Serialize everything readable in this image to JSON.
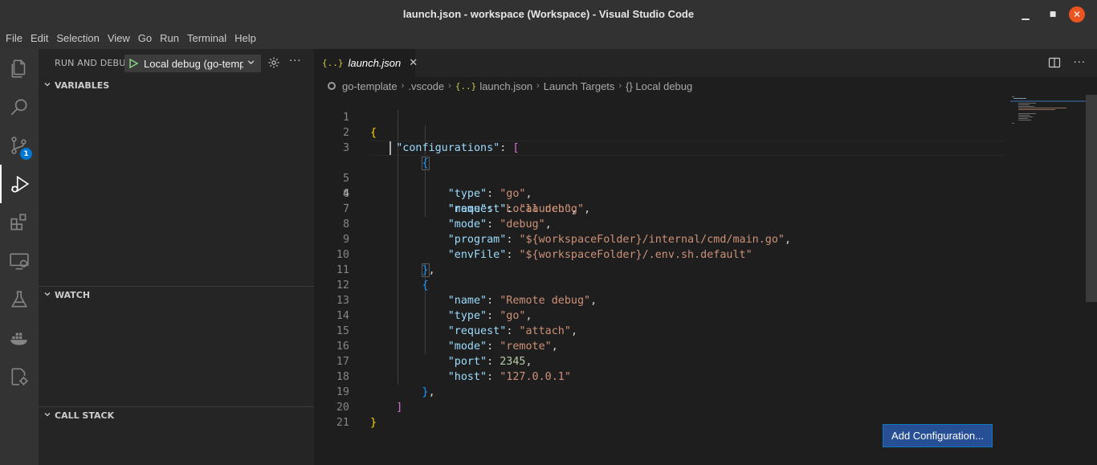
{
  "window": {
    "title": "launch.json - workspace (Workspace) - Visual Studio Code",
    "minimize": "▁",
    "maximize": "■",
    "close": "✕"
  },
  "menu": [
    "File",
    "Edit",
    "Selection",
    "View",
    "Go",
    "Run",
    "Terminal",
    "Help"
  ],
  "activitybar": {
    "scm_badge": "1"
  },
  "sidebar": {
    "title": "RUN AND DEBUG",
    "config_selected": "Local debug (go-template)",
    "more": "···",
    "sections": {
      "variables": "VARIABLES",
      "watch": "WATCH",
      "callstack": "CALL STACK"
    }
  },
  "editor": {
    "tab": {
      "icon": "{..}",
      "name": "launch.json",
      "close": "✕"
    },
    "more": "···",
    "breadcrumbs": {
      "folder": "go-template",
      "subfolder": ".vscode",
      "file_icon": "{..}",
      "file": "launch.json",
      "node": "Launch Targets",
      "leaf": "{} Local debug"
    },
    "current_line": 4,
    "lines": [
      {
        "n": "1"
      },
      {
        "n": "2"
      },
      {
        "n": "3"
      },
      {
        "n": "4"
      },
      {
        "n": "5"
      },
      {
        "n": "6"
      },
      {
        "n": "7"
      },
      {
        "n": "8"
      },
      {
        "n": "9"
      },
      {
        "n": "10"
      },
      {
        "n": "11"
      },
      {
        "n": "12"
      },
      {
        "n": "13"
      },
      {
        "n": "14"
      },
      {
        "n": "15"
      },
      {
        "n": "16"
      },
      {
        "n": "17"
      },
      {
        "n": "18"
      },
      {
        "n": "19"
      },
      {
        "n": "20"
      },
      {
        "n": "21"
      }
    ],
    "code": {
      "configurations_key": "\"configurations\"",
      "name_key": "\"name\"",
      "type_key": "\"type\"",
      "request_key": "\"request\"",
      "mode_key": "\"mode\"",
      "program_key": "\"program\"",
      "envfile_key": "\"envFile\"",
      "port_key": "\"port\"",
      "host_key": "\"host\"",
      "local_name": "\"Local debug\"",
      "local_type": "\"go\"",
      "local_request": "\"launch\"",
      "local_mode": "\"debug\"",
      "local_program": "\"${workspaceFolder}/internal/cmd/main.go\"",
      "local_envfile": "\"${workspaceFolder}/.env.sh.default\"",
      "remote_name": "\"Remote debug\"",
      "remote_type": "\"go\"",
      "remote_request": "\"attach\"",
      "remote_mode": "\"remote\"",
      "remote_port": "2345",
      "remote_host": "\"127.0.0.1\""
    },
    "add_configuration": "Add Configuration..."
  },
  "colors": {
    "accent": "#0078d4",
    "close_button": "#e95420",
    "json_key": "#9cdcfe",
    "json_string": "#ce9178",
    "json_number": "#b5cea8"
  }
}
